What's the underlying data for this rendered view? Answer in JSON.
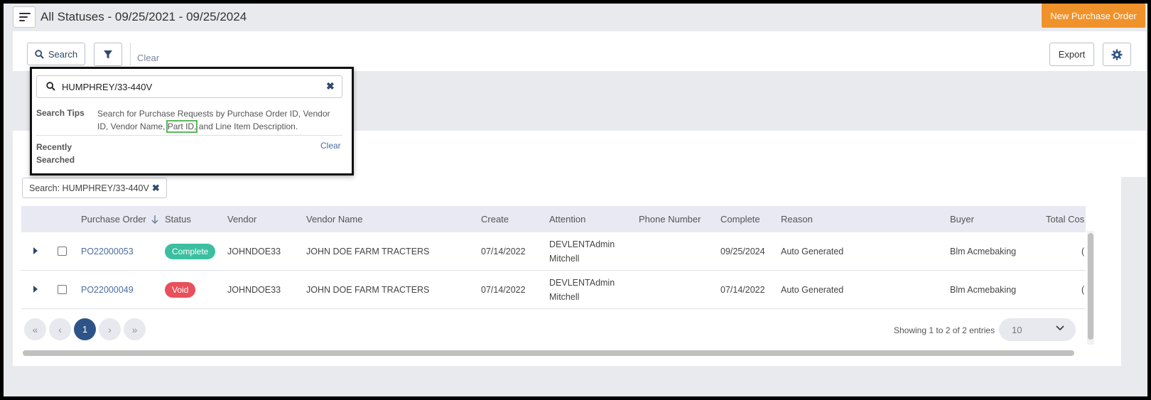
{
  "header": {
    "title": "All Statuses - 09/25/2021 - 09/25/2024",
    "new_po_label": "New Purchase Order"
  },
  "toolbar": {
    "search_label": "Search",
    "clear_label": "Clear",
    "export_label": "Export"
  },
  "search_popup": {
    "query": "HUMPHREY/33-440V",
    "tips_label": "Search Tips",
    "tips_before": "Search for Purchase Requests by Purchase Order ID, Vendor ID, Vendor Name,",
    "tips_highlight": "Part ID,",
    "tips_after": "and Line Item Description.",
    "recent_label": "Recently Searched",
    "recent_clear": "Clear"
  },
  "active_filter": {
    "label": "Search: HUMPHREY/33-440V"
  },
  "table": {
    "columns": [
      "Purchase Order",
      "Status",
      "Vendor",
      "Vendor Name",
      "Create",
      "Attention",
      "Phone Number",
      "Complete",
      "Reason",
      "Buyer",
      "Total Cos"
    ],
    "rows": [
      {
        "po": "PO22000053",
        "status": "Complete",
        "vendor": "JOHNDOE33",
        "vendor_name": "JOHN DOE FARM TRACTERS",
        "create": "07/14/2022",
        "attention_line1": "DEVLENTAdmin",
        "attention_line2": "Mitchell",
        "phone": "",
        "complete": "09/25/2024",
        "reason": "Auto Generated",
        "buyer": "Blm Acmebaking",
        "total": "("
      },
      {
        "po": "PO22000049",
        "status": "Void",
        "vendor": "JOHNDOE33",
        "vendor_name": "JOHN DOE FARM TRACTERS",
        "create": "07/14/2022",
        "attention_line1": "DEVLENTAdmin",
        "attention_line2": "Mitchell",
        "phone": "",
        "complete": "07/14/2022",
        "reason": "Auto Generated",
        "buyer": "Blm Acmebaking",
        "total": "("
      }
    ]
  },
  "pagination": {
    "current_page": "1",
    "showing": "Showing 1 to 2 of 2 entries",
    "page_size": "10"
  },
  "colors": {
    "accent": "#f0922b",
    "primary": "#2e5387",
    "complete": "#3bbf9f",
    "void": "#e8505b"
  }
}
